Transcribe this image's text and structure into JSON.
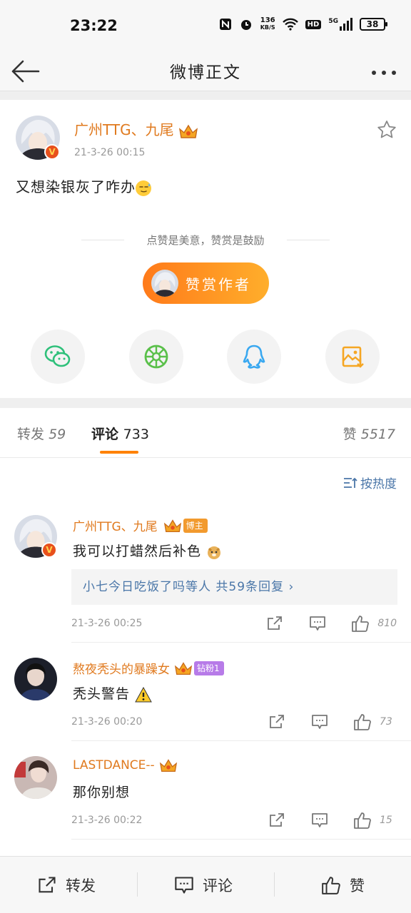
{
  "status_bar": {
    "time": "23:22",
    "net_speed_value": "136",
    "net_speed_unit": "KB/S",
    "hd": "HD",
    "signal": "5G",
    "battery": "38"
  },
  "nav": {
    "title": "微博正文"
  },
  "post": {
    "author": "广州TTG、九尾",
    "time": "21-3-26 00:15",
    "text": "又想染银灰了咋办",
    "reward_slogan": "点赞是美意，赞赏是鼓励",
    "reward_button": "赞赏作者",
    "share_icons": [
      "wechat-icon",
      "moments-icon",
      "qq-icon",
      "save-image-icon"
    ]
  },
  "tabs": [
    {
      "label": "转发",
      "count": "59"
    },
    {
      "label": "评论",
      "count": "733"
    },
    {
      "label": "赞",
      "count": "5517"
    }
  ],
  "sort": {
    "label": "按热度"
  },
  "comments": [
    {
      "name": "广州TTG、九尾",
      "tag": "博主",
      "text": "我可以打蜡然后补色",
      "replies": "小七今日吃饭了吗等人  共59条回复 ›",
      "time": "21-3-26 00:25",
      "likes": "810"
    },
    {
      "name": "熬夜秃头的暴躁女",
      "tag": "钻粉1",
      "text": "秃头警告",
      "time": "21-3-26 00:20",
      "likes": "73"
    },
    {
      "name": "LASTDANCE--",
      "text": "那你别想",
      "time": "21-3-26 00:22",
      "likes": "15"
    }
  ],
  "bottom_bar": {
    "repost": "转发",
    "comment": "评论",
    "like": "赞"
  },
  "colors": {
    "accent_orange": "#ff8200",
    "name_orange": "#e07a1f",
    "link_blue": "#4a76a8",
    "blogger_tag": "#f29a2e",
    "fan_tag": "#b77be8"
  }
}
